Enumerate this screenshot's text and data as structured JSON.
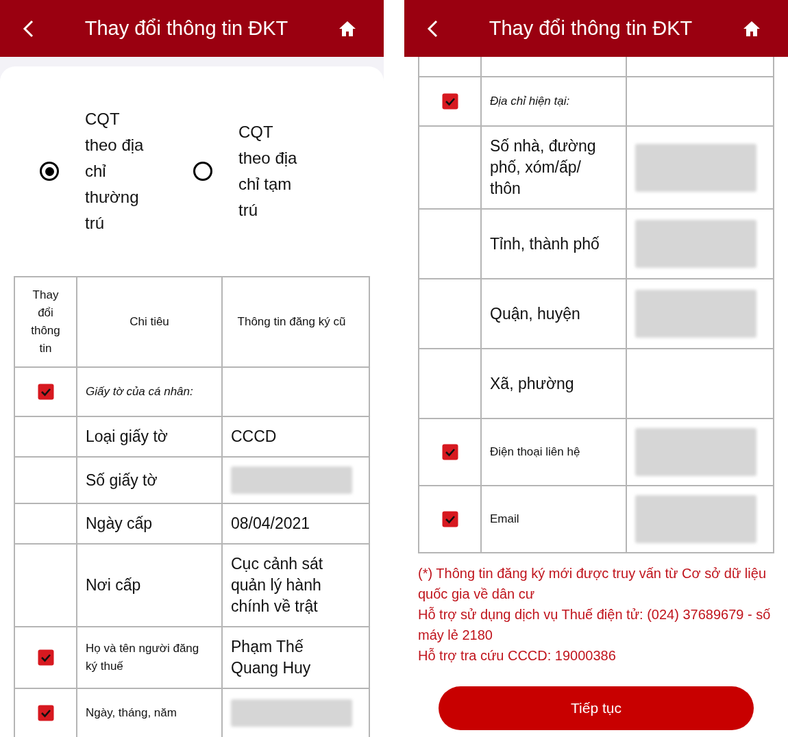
{
  "screens": [
    {
      "header": {
        "title": "Thay đổi thông tin ĐKT"
      },
      "radios": [
        {
          "label": "CQT theo địa chỉ thường trú",
          "selected": true
        },
        {
          "label": "CQT theo địa chỉ tạm trú",
          "selected": false
        }
      ],
      "table": {
        "columns": [
          "Thay đổi thông tin",
          "Chi tiêu",
          "Thông tin đăng ký cũ"
        ],
        "rows": [
          {
            "kind": "section",
            "label": "Giấy tờ của cá nhân:",
            "checked": true
          },
          {
            "kind": "field",
            "label": "Loại giấy tờ",
            "value": "CCCD",
            "checked": false
          },
          {
            "kind": "field",
            "label": "Số giấy tờ",
            "value_blurred": true,
            "checked": false
          },
          {
            "kind": "field",
            "label": "Ngày cấp",
            "value": "08/04/2021",
            "checked": false
          },
          {
            "kind": "field",
            "label": "Nơi cấp",
            "value": "Cục cảnh sát quản lý hành chính về trật",
            "checked": false
          },
          {
            "kind": "small",
            "label": "Họ và tên người đăng ký thuế",
            "value": "Phạm Thế Quang Huy",
            "checked": true
          },
          {
            "kind": "small",
            "label": "Ngày, tháng, năm",
            "value_blurred": true,
            "checked": true
          }
        ]
      }
    },
    {
      "header": {
        "title": "Thay đổi thông tin ĐKT"
      },
      "table": {
        "rows": [
          {
            "kind": "section",
            "label": "Địa chỉ hiện tại:",
            "checked": true
          },
          {
            "kind": "field",
            "label": "Số nhà, đường phố, xóm/ấp/ thôn",
            "value_blurred": true,
            "checked": false
          },
          {
            "kind": "field",
            "label": "Tỉnh, thành phố",
            "value_blurred": true,
            "checked": false
          },
          {
            "kind": "field",
            "label": "Quận, huyện",
            "value_blurred": true,
            "checked": false
          },
          {
            "kind": "field",
            "label": "Xã, phường",
            "checked": false
          },
          {
            "kind": "small",
            "label": "Điện thoại liên hệ",
            "value_blurred": true,
            "checked": true
          },
          {
            "kind": "small",
            "label": "Email",
            "value_blurred": true,
            "checked": true
          }
        ]
      },
      "notes": [
        "(*) Thông tin đăng ký mới được truy vấn từ Cơ sở dữ liệu quốc gia về dân cư",
        "Hỗ trợ sử dụng dịch vụ Thuế điện tử: (024) 37689679 - số máy lẻ 2180",
        "Hỗ trợ tra cứu CCCD: 19000386"
      ],
      "button": "Tiếp tục"
    }
  ]
}
